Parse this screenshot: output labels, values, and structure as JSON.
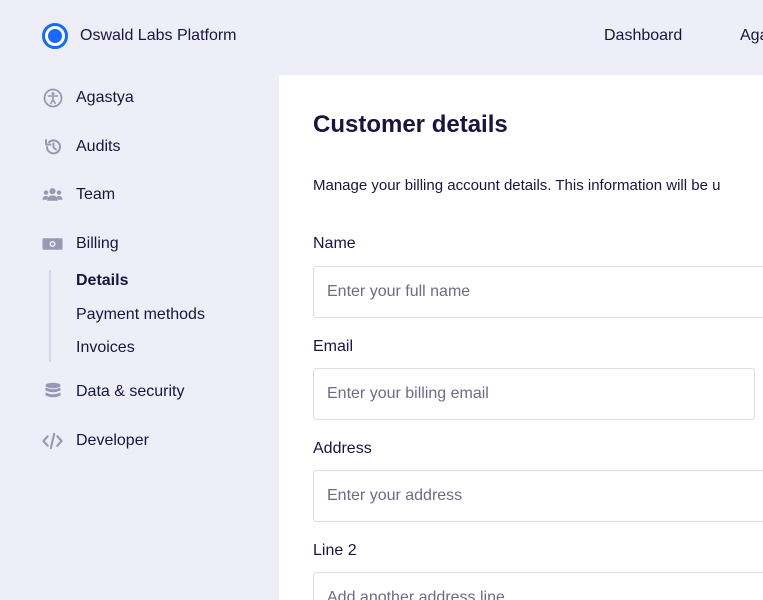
{
  "app": {
    "title": "Oswald Labs Platform"
  },
  "topnav": {
    "items": [
      "Dashboard",
      "Agastya"
    ]
  },
  "sidebar": {
    "items": [
      {
        "label": "Agastya",
        "icon": "accessibility-icon"
      },
      {
        "label": "Audits",
        "icon": "history-icon"
      },
      {
        "label": "Team",
        "icon": "users-icon"
      },
      {
        "label": "Billing",
        "icon": "money-icon"
      },
      {
        "label": "Data & security",
        "icon": "database-icon"
      },
      {
        "label": "Developer",
        "icon": "code-icon"
      }
    ],
    "billing_sub": [
      {
        "label": "Details",
        "active": true
      },
      {
        "label": "Payment methods",
        "active": false
      },
      {
        "label": "Invoices",
        "active": false
      }
    ]
  },
  "main": {
    "title": "Customer details",
    "description": "Manage your billing account details. This information will be u",
    "fields": [
      {
        "label": "Name",
        "placeholder": "Enter your full name",
        "value": ""
      },
      {
        "label": "Email",
        "placeholder": "Enter your billing email",
        "value": ""
      },
      {
        "label": "Address",
        "placeholder": "Enter your address",
        "value": ""
      },
      {
        "label": "Line 2",
        "placeholder": "Add another address line",
        "value": ""
      }
    ]
  },
  "colors": {
    "accent": "#1769ff",
    "background": "#eeeef8",
    "text": "#1b1340",
    "icon": "#9a97b3"
  }
}
